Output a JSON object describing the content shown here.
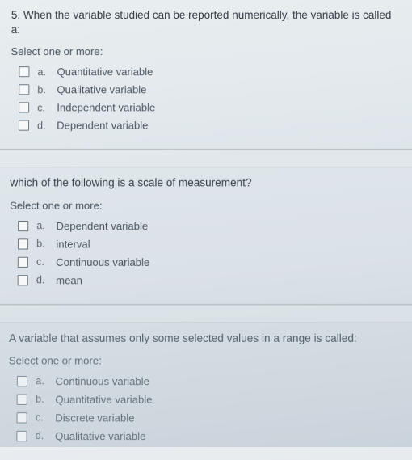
{
  "questions": [
    {
      "number": "5.",
      "stem": "When the variable studied can be reported numerically, the variable is called a:",
      "instruction": "Select one or more:",
      "options": [
        {
          "letter": "a.",
          "text": "Quantitative variable"
        },
        {
          "letter": "b.",
          "text": "Qualitative variable"
        },
        {
          "letter": "c.",
          "text": "Independent variable"
        },
        {
          "letter": "d.",
          "text": "Dependent variable"
        }
      ]
    },
    {
      "number": "",
      "stem": "which of the following is a scale of measurement?",
      "instruction": "Select one or more:",
      "options": [
        {
          "letter": "a.",
          "text": "Dependent variable"
        },
        {
          "letter": "b.",
          "text": "interval"
        },
        {
          "letter": "c.",
          "text": "Continuous variable"
        },
        {
          "letter": "d.",
          "text": "mean"
        }
      ]
    },
    {
      "number": "",
      "stem": "A variable that assumes only some selected values in a range is called:",
      "instruction": "Select one or more:",
      "options": [
        {
          "letter": "a.",
          "text": "Continuous variable"
        },
        {
          "letter": "b.",
          "text": "Quantitative variable"
        },
        {
          "letter": "c.",
          "text": "Discrete variable"
        },
        {
          "letter": "d.",
          "text": "Qualitative variable"
        }
      ]
    }
  ]
}
